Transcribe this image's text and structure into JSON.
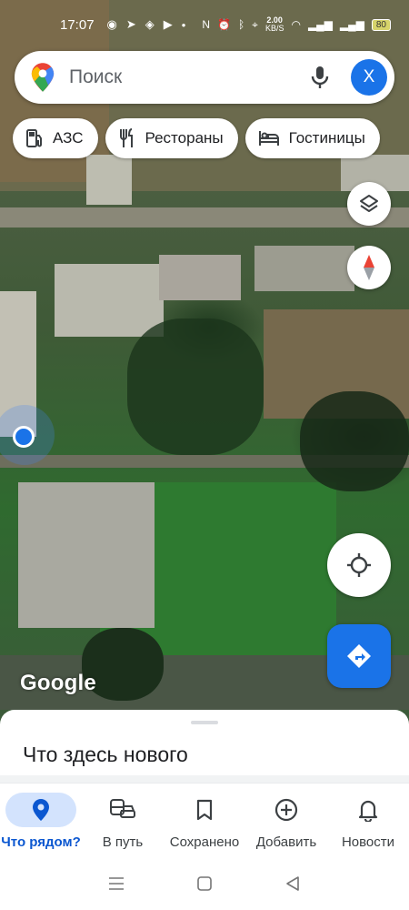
{
  "status_bar": {
    "time": "17:07",
    "net_speed_value": "2.00",
    "net_speed_unit": "KB/S",
    "battery": "80"
  },
  "search": {
    "placeholder": "Поиск",
    "avatar_letter": "X"
  },
  "chips": [
    {
      "label": "АЗС",
      "icon": "gas-station-icon"
    },
    {
      "label": "Рестораны",
      "icon": "restaurant-icon"
    },
    {
      "label": "Гостиницы",
      "icon": "hotel-icon"
    }
  ],
  "map": {
    "attribution": "Google"
  },
  "sheet": {
    "title": "Что здесь нового"
  },
  "bottom_nav": [
    {
      "label": "Что рядом?",
      "icon": "location-pin-icon",
      "active": true
    },
    {
      "label": "В путь",
      "icon": "commute-icon",
      "active": false
    },
    {
      "label": "Сохранено",
      "icon": "bookmark-icon",
      "active": false
    },
    {
      "label": "Добавить",
      "icon": "add-circle-icon",
      "active": false
    },
    {
      "label": "Новости",
      "icon": "bell-icon",
      "active": false
    }
  ],
  "colors": {
    "accent": "#1a73e8",
    "active_nav": "#0b57d0"
  }
}
